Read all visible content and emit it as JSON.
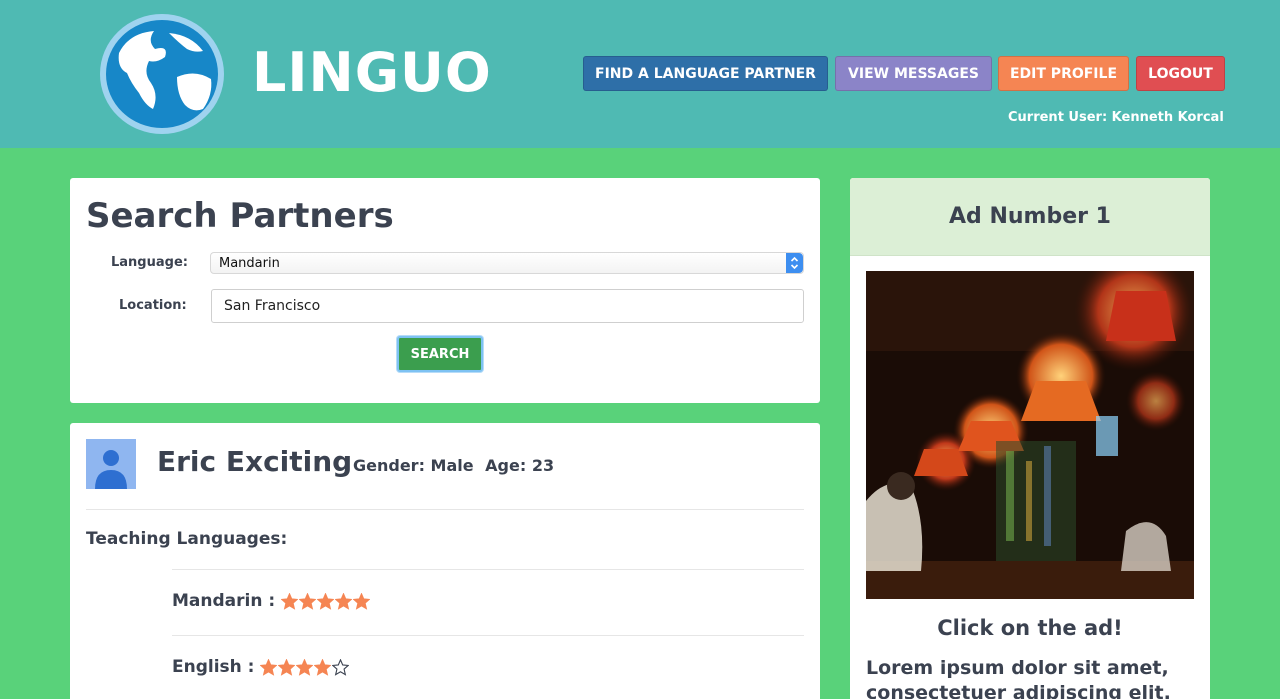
{
  "header": {
    "logo_text": "LINGUO",
    "nav": {
      "find_partner": "FIND A LANGUAGE PARTNER",
      "view_messages": "VIEW MESSAGES",
      "edit_profile": "EDIT PROFILE",
      "logout": "LOGOUT"
    },
    "current_user": "Current User: Kenneth Korcal"
  },
  "search": {
    "title": "Search Partners",
    "language_label": "Language:",
    "language_value": "Mandarin",
    "location_label": "Location:",
    "location_value": "San Francisco",
    "button_label": "SEARCH"
  },
  "partner": {
    "name": "Eric Exciting",
    "gender": "Gender: Male",
    "age": "Age: 23",
    "teaching_label": "Teaching Languages:",
    "languages": [
      {
        "name": "Mandarin :",
        "rating": 5,
        "max": 5
      },
      {
        "name": "English :",
        "rating": 4,
        "max": 5
      }
    ]
  },
  "ad": {
    "title": "Ad Number 1",
    "cta": "Click on the ad!",
    "body": "Lorem ipsum dolor sit amet, consectetuer adipiscing elit."
  },
  "colors": {
    "header_bg": "#4fbab3",
    "page_bg": "#59d27a",
    "find_btn": "#2e6fa8",
    "messages_btn": "#8b84c8",
    "edit_btn": "#f58553",
    "logout_btn": "#e04e52",
    "search_btn": "#3b9e4e",
    "star": "#f58553"
  }
}
